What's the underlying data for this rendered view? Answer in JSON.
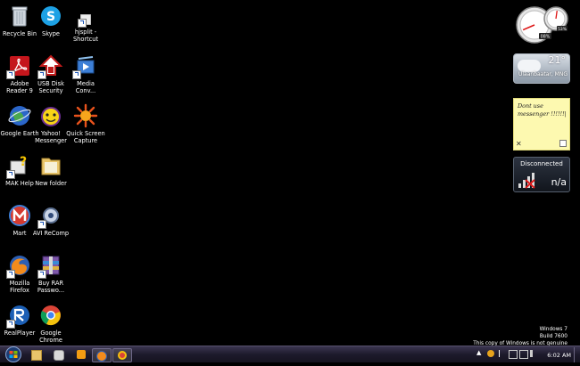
{
  "desktop_icons": [
    {
      "label": "Recycle Bin",
      "icon": "recycle-bin-icon"
    },
    {
      "label": "Skype",
      "icon": "skype-icon"
    },
    {
      "label": "hjsplit -\nShortcut",
      "icon": "hjsplit-icon"
    },
    {
      "label": "Adobe\nReader 9",
      "icon": "adobe-reader-icon"
    },
    {
      "label": "USB Disk\nSecurity",
      "icon": "usb-disk-security-icon"
    },
    {
      "label": "Media\nConv...",
      "icon": "media-converter-icon"
    },
    {
      "label": "Google Earth",
      "icon": "google-earth-icon"
    },
    {
      "label": "Yahoo!\nMessenger",
      "icon": "yahoo-messenger-icon"
    },
    {
      "label": "Quick Screen\nCapture",
      "icon": "quick-screen-capture-icon"
    },
    {
      "label": "MAK Help",
      "icon": "mak-help-icon"
    },
    {
      "label": "New folder",
      "icon": "folder-icon"
    },
    {
      "label": "Mart",
      "icon": "mart-icon"
    },
    {
      "label": "AVI ReComp",
      "icon": "avi-recomp-icon"
    },
    {
      "label": "Mozilla\nFirefox",
      "icon": "firefox-icon"
    },
    {
      "label": "Buy RAR\nPasswo...",
      "icon": "buy-rar-icon"
    },
    {
      "label": "RealPlayer",
      "icon": "realplayer-icon"
    },
    {
      "label": "Google\nChrome",
      "icon": "chrome-icon"
    }
  ],
  "gadgets": {
    "cpu_meter": {
      "cpu": "08%",
      "mem": "53%",
      "cpu_level": 0.08,
      "mem_level": 0.53
    },
    "weather": {
      "temp": "21°",
      "location": "Ulaanbaatar, MNG"
    },
    "sticky_note": {
      "text": "Dont use\nmessenger !!!!!!|"
    },
    "network": {
      "status": "Disconnected",
      "value": "n/a"
    }
  },
  "watermark": {
    "line1": "Windows 7",
    "line2": "Build 7600",
    "line3": "This copy of Windows is not genuine"
  },
  "taskbar": {
    "clock": "6:02 AM",
    "buttons": [
      "explorer-icon",
      "paint-icon",
      "media-player-icon",
      "firefox-icon",
      "chrome-icon"
    ]
  }
}
